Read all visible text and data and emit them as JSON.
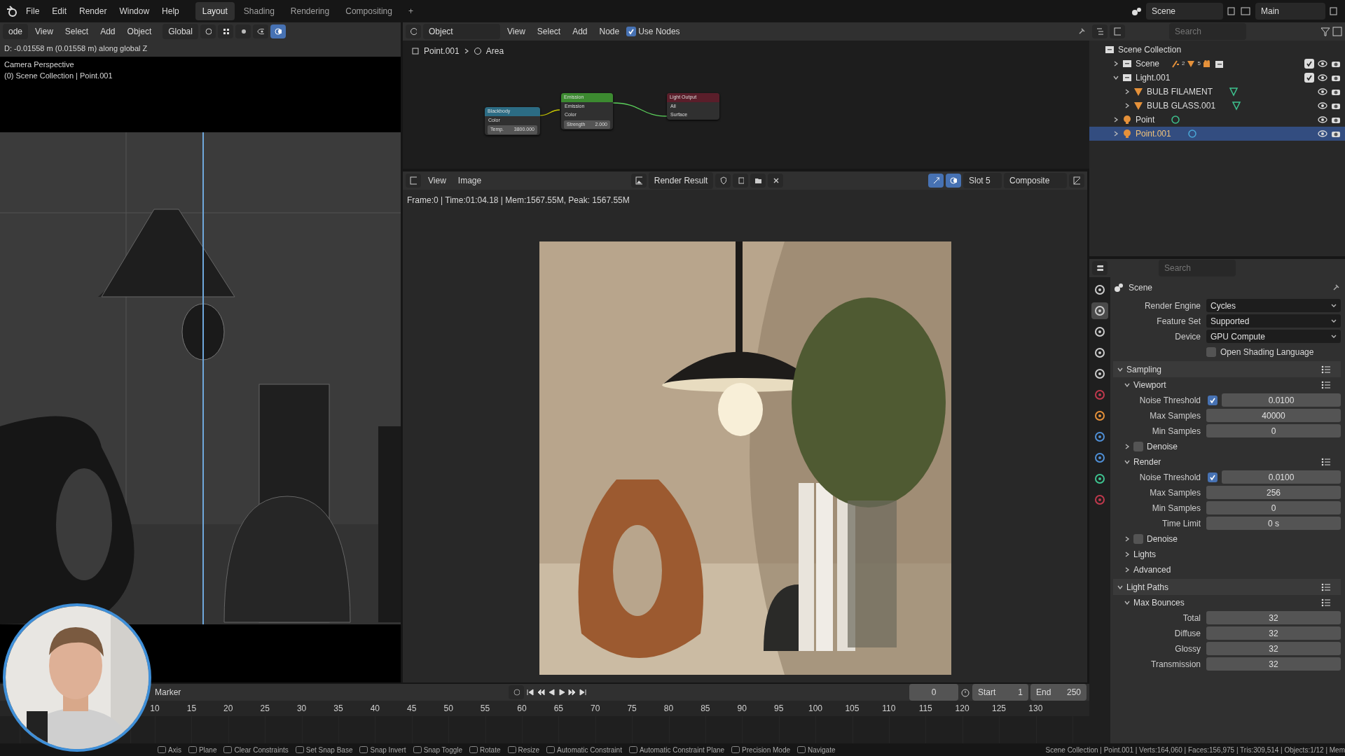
{
  "topbar": {
    "menus": [
      "File",
      "Edit",
      "Render",
      "Window",
      "Help"
    ],
    "workspaces": [
      {
        "label": "Layout",
        "selected": true
      },
      {
        "label": "Shading",
        "selected": false
      },
      {
        "label": "Rendering",
        "selected": false
      },
      {
        "label": "Compositing",
        "selected": false
      }
    ],
    "add_tab": "+",
    "scene": "Scene",
    "view_layer": "Main"
  },
  "viewport": {
    "mode": "ode",
    "menus": [
      "View",
      "Select",
      "Add",
      "Object"
    ],
    "orientation": "Global",
    "operator_info": "D: -0.01558 m (0.01558 m) along global Z",
    "overlay_lines": [
      "Camera Perspective",
      "(0) Scene Collection | Point.001"
    ]
  },
  "node_editor": {
    "mode": "Object",
    "menus": [
      "View",
      "Select",
      "Add",
      "Node"
    ],
    "use_nodes": {
      "label": "Use Nodes",
      "checked": true
    },
    "breadcrumb": [
      "Point.001",
      "Area"
    ],
    "nodes": [
      {
        "title": "Blackbody",
        "color": "#2c6c84",
        "rows": [
          [
            "Color"
          ],
          [
            "Temp.",
            "3800.000"
          ]
        ]
      },
      {
        "title": "Emission",
        "color": "#3c8a30",
        "rows": [
          [
            "Emission"
          ],
          [
            "Color"
          ],
          [
            "Strength",
            "2.000"
          ]
        ]
      },
      {
        "title": "Light Output",
        "color": "#5a1e2a",
        "rows": [
          [
            "All"
          ],
          [
            "Surface"
          ]
        ]
      }
    ]
  },
  "image_editor": {
    "menus": [
      "View",
      "Image"
    ],
    "image": "Render Result",
    "slot": "Slot 5",
    "pass": "Composite",
    "info": "Frame:0 | Time:01:04.18 | Mem:1567.55M, Peak: 1567.55M",
    "render": {
      "kind": "picture"
    }
  },
  "outliner": {
    "search": {
      "placeholder": "Search"
    },
    "tree": [
      {
        "label": "Scene Collection",
        "kind": "root",
        "selected": false,
        "children": [
          {
            "label": "Scene",
            "kind": "collection",
            "selected": false,
            "expanded": false,
            "checked": true,
            "counts": [
              "2",
              "5"
            ]
          },
          {
            "label": "Light.001",
            "kind": "collection",
            "selected": false,
            "expanded": true,
            "checked": true,
            "children": [
              {
                "label": "BULB FILAMENT",
                "kind": "mesh",
                "selected": false,
                "expanded": false
              },
              {
                "label": "BULB GLASS.001",
                "kind": "mesh",
                "selected": false,
                "expanded": false
              }
            ]
          },
          {
            "label": "Point",
            "kind": "light",
            "selected": false,
            "expanded": false
          },
          {
            "label": "Point.001",
            "kind": "light",
            "selected": true,
            "expanded": false
          }
        ]
      }
    ]
  },
  "properties": {
    "search": {
      "placeholder": "Search"
    },
    "context": "Scene",
    "tabs": [
      {
        "selected": false
      },
      {
        "selected": true
      },
      {
        "selected": false
      },
      {
        "selected": false
      },
      {
        "selected": false
      },
      {
        "selected": false
      },
      {
        "selected": false
      },
      {
        "selected": false
      },
      {
        "selected": false
      },
      {
        "selected": false
      },
      {
        "selected": false
      }
    ],
    "rows": [
      {
        "kind": "select",
        "label": "Render Engine",
        "value": "Cycles"
      },
      {
        "kind": "select",
        "label": "Feature Set",
        "value": "Supported"
      },
      {
        "kind": "select",
        "label": "Device",
        "value": "GPU Compute"
      },
      {
        "kind": "check",
        "label": "Open Shading Language",
        "checked": false
      },
      {
        "kind": "panel",
        "label": "Sampling",
        "expanded": true
      },
      {
        "kind": "subpanel",
        "label": "Viewport",
        "expanded": true
      },
      {
        "kind": "check_number",
        "label": "Noise Threshold",
        "checked": true,
        "value": "0.0100"
      },
      {
        "kind": "number",
        "label": "Max Samples",
        "value": "40000"
      },
      {
        "kind": "number",
        "label": "Min Samples",
        "value": "0"
      },
      {
        "kind": "subcheck",
        "label": "Denoise",
        "expanded": false,
        "checked": false
      },
      {
        "kind": "subpanel",
        "label": "Render",
        "expanded": true
      },
      {
        "kind": "check_number",
        "label": "Noise Threshold",
        "checked": true,
        "value": "0.0100"
      },
      {
        "kind": "number",
        "label": "Max Samples",
        "value": "256"
      },
      {
        "kind": "number",
        "label": "Min Samples",
        "value": "0"
      },
      {
        "kind": "number",
        "label": "Time Limit",
        "value": "0 s"
      },
      {
        "kind": "subcheck",
        "label": "Denoise",
        "expanded": false,
        "checked": false
      },
      {
        "kind": "subpanel",
        "label": "Lights",
        "expanded": false
      },
      {
        "kind": "subpanel",
        "label": "Advanced",
        "expanded": false
      },
      {
        "kind": "panel",
        "label": "Light Paths",
        "expanded": true
      },
      {
        "kind": "subpanel",
        "label": "Max Bounces",
        "expanded": true
      },
      {
        "kind": "number",
        "label": "Total",
        "value": "32"
      },
      {
        "kind": "number",
        "label": "Diffuse",
        "value": "32"
      },
      {
        "kind": "number",
        "label": "Glossy",
        "value": "32"
      },
      {
        "kind": "number",
        "label": "Transmission",
        "value": "32"
      }
    ]
  },
  "timeline": {
    "menu": "Marker",
    "current_frame": "0",
    "start_label": "Start",
    "start": "1",
    "end_label": "End",
    "end": "250",
    "ticks": [
      "10",
      "15",
      "20",
      "25",
      "30",
      "35",
      "40",
      "45",
      "50",
      "55",
      "60",
      "65",
      "70",
      "75",
      "80",
      "85",
      "90",
      "95",
      "100",
      "105",
      "110",
      "115",
      "120",
      "125",
      "130"
    ]
  },
  "status_bar": {
    "hints": [
      "Axis",
      "Plane",
      "Clear Constraints",
      "Set Snap Base",
      "Snap Invert",
      "Snap Toggle",
      "Rotate",
      "Resize",
      "Automatic Constraint",
      "Automatic Constraint Plane",
      "Precision Mode",
      "Navigate"
    ],
    "stats": "Scene Collection | Point.001 | Verts:164,060 | Faces:156,975 | Tris:309,514 | Objects:1/12 | Mem"
  },
  "webcam": {
    "kind": "picture"
  }
}
